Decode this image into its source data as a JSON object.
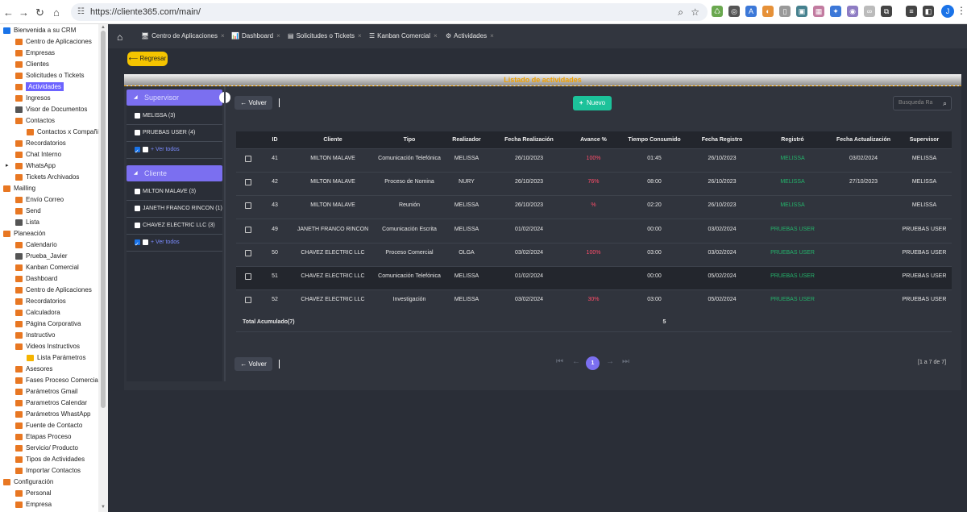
{
  "browser": {
    "url": "https://cliente365.com/main/",
    "avatar_letter": "J"
  },
  "sidebar": {
    "items": [
      {
        "label": "Bienvenida a su CRM",
        "level": 0,
        "color": "#1a73e8",
        "caret": true
      },
      {
        "label": "Centro de Aplicaciones",
        "level": 1,
        "color": "#e87722"
      },
      {
        "label": "Empresas",
        "level": 1,
        "color": "#e87722"
      },
      {
        "label": "Clientes",
        "level": 1,
        "color": "#e87722"
      },
      {
        "label": "Solicitudes o Tickets",
        "level": 1,
        "color": "#e87722"
      },
      {
        "label": "Actividades",
        "level": 1,
        "color": "#e87722",
        "active": true
      },
      {
        "label": "Ingresos",
        "level": 1,
        "color": "#e87722"
      },
      {
        "label": "Visor de Documentos",
        "level": 1,
        "color": "#555"
      },
      {
        "label": "Contactos",
        "level": 1,
        "color": "#e87722"
      },
      {
        "label": "Contactos x Compañía",
        "level": 2,
        "color": "#e87722"
      },
      {
        "label": "Recordatorios",
        "level": 1,
        "color": "#e87722"
      },
      {
        "label": "Chat Interno",
        "level": 1,
        "color": "#e87722"
      },
      {
        "label": "WhatsApp",
        "level": 1,
        "color": "#e87722",
        "caret": true
      },
      {
        "label": "Tickets Archivados",
        "level": 1,
        "color": "#e87722"
      },
      {
        "label": "Mailling",
        "level": 0,
        "color": "#e87722"
      },
      {
        "label": "Envío Correo",
        "level": 1,
        "color": "#e87722"
      },
      {
        "label": "Send",
        "level": 1,
        "color": "#e87722"
      },
      {
        "label": "Lista",
        "level": 1,
        "color": "#555"
      },
      {
        "label": "Planeación",
        "level": 0,
        "color": "#e87722"
      },
      {
        "label": "Calendario",
        "level": 1,
        "color": "#e87722"
      },
      {
        "label": "Prueba_Javier",
        "level": 1,
        "color": "#555"
      },
      {
        "label": "Kanban Comercial",
        "level": 1,
        "color": "#e87722"
      },
      {
        "label": "Dashboard",
        "level": 1,
        "color": "#e87722"
      },
      {
        "label": "Centro de Aplicaciones",
        "level": 1,
        "color": "#e87722"
      },
      {
        "label": "Recordatorios",
        "level": 1,
        "color": "#e87722"
      },
      {
        "label": "Calculadora",
        "level": 1,
        "color": "#e87722"
      },
      {
        "label": "Página Corporativa",
        "level": 1,
        "color": "#e87722"
      },
      {
        "label": "Instructivo",
        "level": 1,
        "color": "#e87722"
      },
      {
        "label": "Videos Instructivos",
        "level": 1,
        "color": "#e87722"
      },
      {
        "label": "Lista Parámetros",
        "level": 2,
        "color": "#f5b400"
      },
      {
        "label": "Asesores",
        "level": 1,
        "color": "#e87722"
      },
      {
        "label": "Fases Proceso Comercial",
        "level": 1,
        "color": "#e87722"
      },
      {
        "label": "Parámetros Gmail",
        "level": 1,
        "color": "#e87722"
      },
      {
        "label": "Parametros Calendar",
        "level": 1,
        "color": "#e87722"
      },
      {
        "label": "Parámetros WhastApp",
        "level": 1,
        "color": "#e87722"
      },
      {
        "label": "Fuente de Contacto",
        "level": 1,
        "color": "#e87722"
      },
      {
        "label": "Etapas Proceso",
        "level": 1,
        "color": "#e87722"
      },
      {
        "label": "Servicio/ Producto",
        "level": 1,
        "color": "#e87722"
      },
      {
        "label": "Tipos de Actividades",
        "level": 1,
        "color": "#e87722"
      },
      {
        "label": "Importar Contactos",
        "level": 1,
        "color": "#e87722"
      },
      {
        "label": "Configuración",
        "level": 0,
        "color": "#e87722"
      },
      {
        "label": "Personal",
        "level": 1,
        "color": "#e87722"
      },
      {
        "label": "Empresa",
        "level": 1,
        "color": "#e87722"
      }
    ]
  },
  "tabs": [
    {
      "label": "Centro de Aplicaciones",
      "icon": "🖥"
    },
    {
      "label": "Dashboard",
      "icon": "📊"
    },
    {
      "label": "Solicitudes o Tickets",
      "icon": "▤"
    },
    {
      "label": "Kanban Comercial",
      "icon": "☰"
    },
    {
      "label": "Actividades",
      "icon": "⚙"
    }
  ],
  "regresar_label": "⟵ Regresar",
  "list_title": "Listado de actividades",
  "filters": {
    "supervisor": {
      "title": "Supervisor",
      "items": [
        {
          "label": "MELISSA",
          "count": "(3)"
        },
        {
          "label": "PRUEBAS USER",
          "count": "(4)"
        }
      ],
      "ver_todos": "+ Ver todos"
    },
    "cliente": {
      "title": "Cliente",
      "items": [
        {
          "label": "MILTON MALAVE",
          "count": "(3)"
        },
        {
          "label": "JANETH FRANCO RINCON",
          "count": "(1)"
        },
        {
          "label": "CHAVEZ ELECTRIC LLC",
          "count": "(3)"
        }
      ],
      "ver_todos": "+ Ver todos"
    }
  },
  "toolbar": {
    "volver_label": "Volver",
    "nuevo_label": "Nuevo",
    "search_placeholder": "Busqueda Ra"
  },
  "table": {
    "headers": [
      "ID",
      "Cliente",
      "Tipo",
      "Realizador",
      "Fecha Realización",
      "Avance %",
      "Tiempo Consumido",
      "Fecha Registro",
      "Registró",
      "Fecha Actualización",
      "Supervisor"
    ],
    "rows": [
      [
        "41",
        "MILTON MALAVE",
        "Comunicación Telefónica",
        "MELISSA",
        "26/10/2023",
        "100%",
        "01:45",
        "26/10/2023",
        "MELISSA",
        "03/02/2024",
        "MELISSA"
      ],
      [
        "42",
        "MILTON MALAVE",
        "Proceso de Nomina",
        "NURY",
        "26/10/2023",
        "76%",
        "08:00",
        "26/10/2023",
        "MELISSA",
        "27/10/2023",
        "MELISSA"
      ],
      [
        "43",
        "MILTON MALAVE",
        "Reunión",
        "MELISSA",
        "26/10/2023",
        "%",
        "02:20",
        "26/10/2023",
        "MELISSA",
        "",
        "MELISSA"
      ],
      [
        "49",
        "JANETH FRANCO RINCON",
        "Comunicación Escrita",
        "MELISSA",
        "01/02/2024",
        "",
        "00:00",
        "03/02/2024",
        "PRUEBAS USER",
        "",
        "PRUEBAS USER"
      ],
      [
        "50",
        "CHAVEZ ELECTRIC LLC",
        "Proceso Comercial",
        "OLGA",
        "03/02/2024",
        "100%",
        "03:00",
        "03/02/2024",
        "PRUEBAS USER",
        "",
        "PRUEBAS USER"
      ],
      [
        "51",
        "CHAVEZ ELECTRIC LLC",
        "Comunicación Telefónica",
        "MELISSA",
        "01/02/2024",
        "",
        "00:00",
        "05/02/2024",
        "PRUEBAS USER",
        "",
        "PRUEBAS USER"
      ],
      [
        "52",
        "CHAVEZ ELECTRIC LLC",
        "Investigación",
        "MELISSA",
        "03/02/2024",
        "30%",
        "03:00",
        "05/02/2024",
        "PRUEBAS USER",
        "",
        "PRUEBAS USER"
      ]
    ],
    "total_label": "Total Acumulado(7)",
    "total_value": "5"
  },
  "pager": {
    "current": "1",
    "count": "[1 a 7 de 7]"
  }
}
